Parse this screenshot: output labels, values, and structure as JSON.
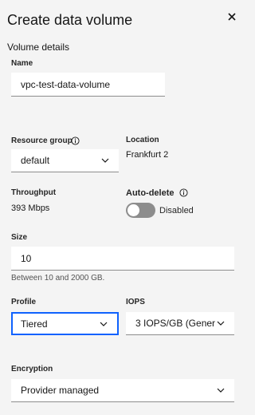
{
  "header": {
    "title": "Create data volume"
  },
  "section": {
    "title": "Volume details"
  },
  "fields": {
    "name": {
      "label": "Name",
      "value": "vpc-test-data-volume"
    },
    "resource_group": {
      "label": "Resource group",
      "value": "default"
    },
    "location": {
      "label": "Location",
      "value": "Frankfurt 2"
    },
    "throughput": {
      "label": "Throughput",
      "value": "393 Mbps"
    },
    "auto_delete": {
      "label": "Auto-delete",
      "state": "Disabled",
      "on": false
    },
    "size": {
      "label": "Size",
      "value": "10",
      "helper": "Between 10 and 2000 GB."
    },
    "profile": {
      "label": "Profile",
      "value": "Tiered"
    },
    "iops": {
      "label": "IOPS",
      "value": "3 IOPS/GB (Gener"
    },
    "encryption": {
      "label": "Encryption",
      "value": "Provider managed"
    }
  },
  "icons": {
    "close": "close-icon",
    "info": "info-icon",
    "chevron": "chevron-down-icon"
  },
  "colors": {
    "focus": "#0f62fe",
    "background": "#f4f4f4",
    "field": "#ffffff",
    "toggle_off": "#8d8d8d"
  }
}
